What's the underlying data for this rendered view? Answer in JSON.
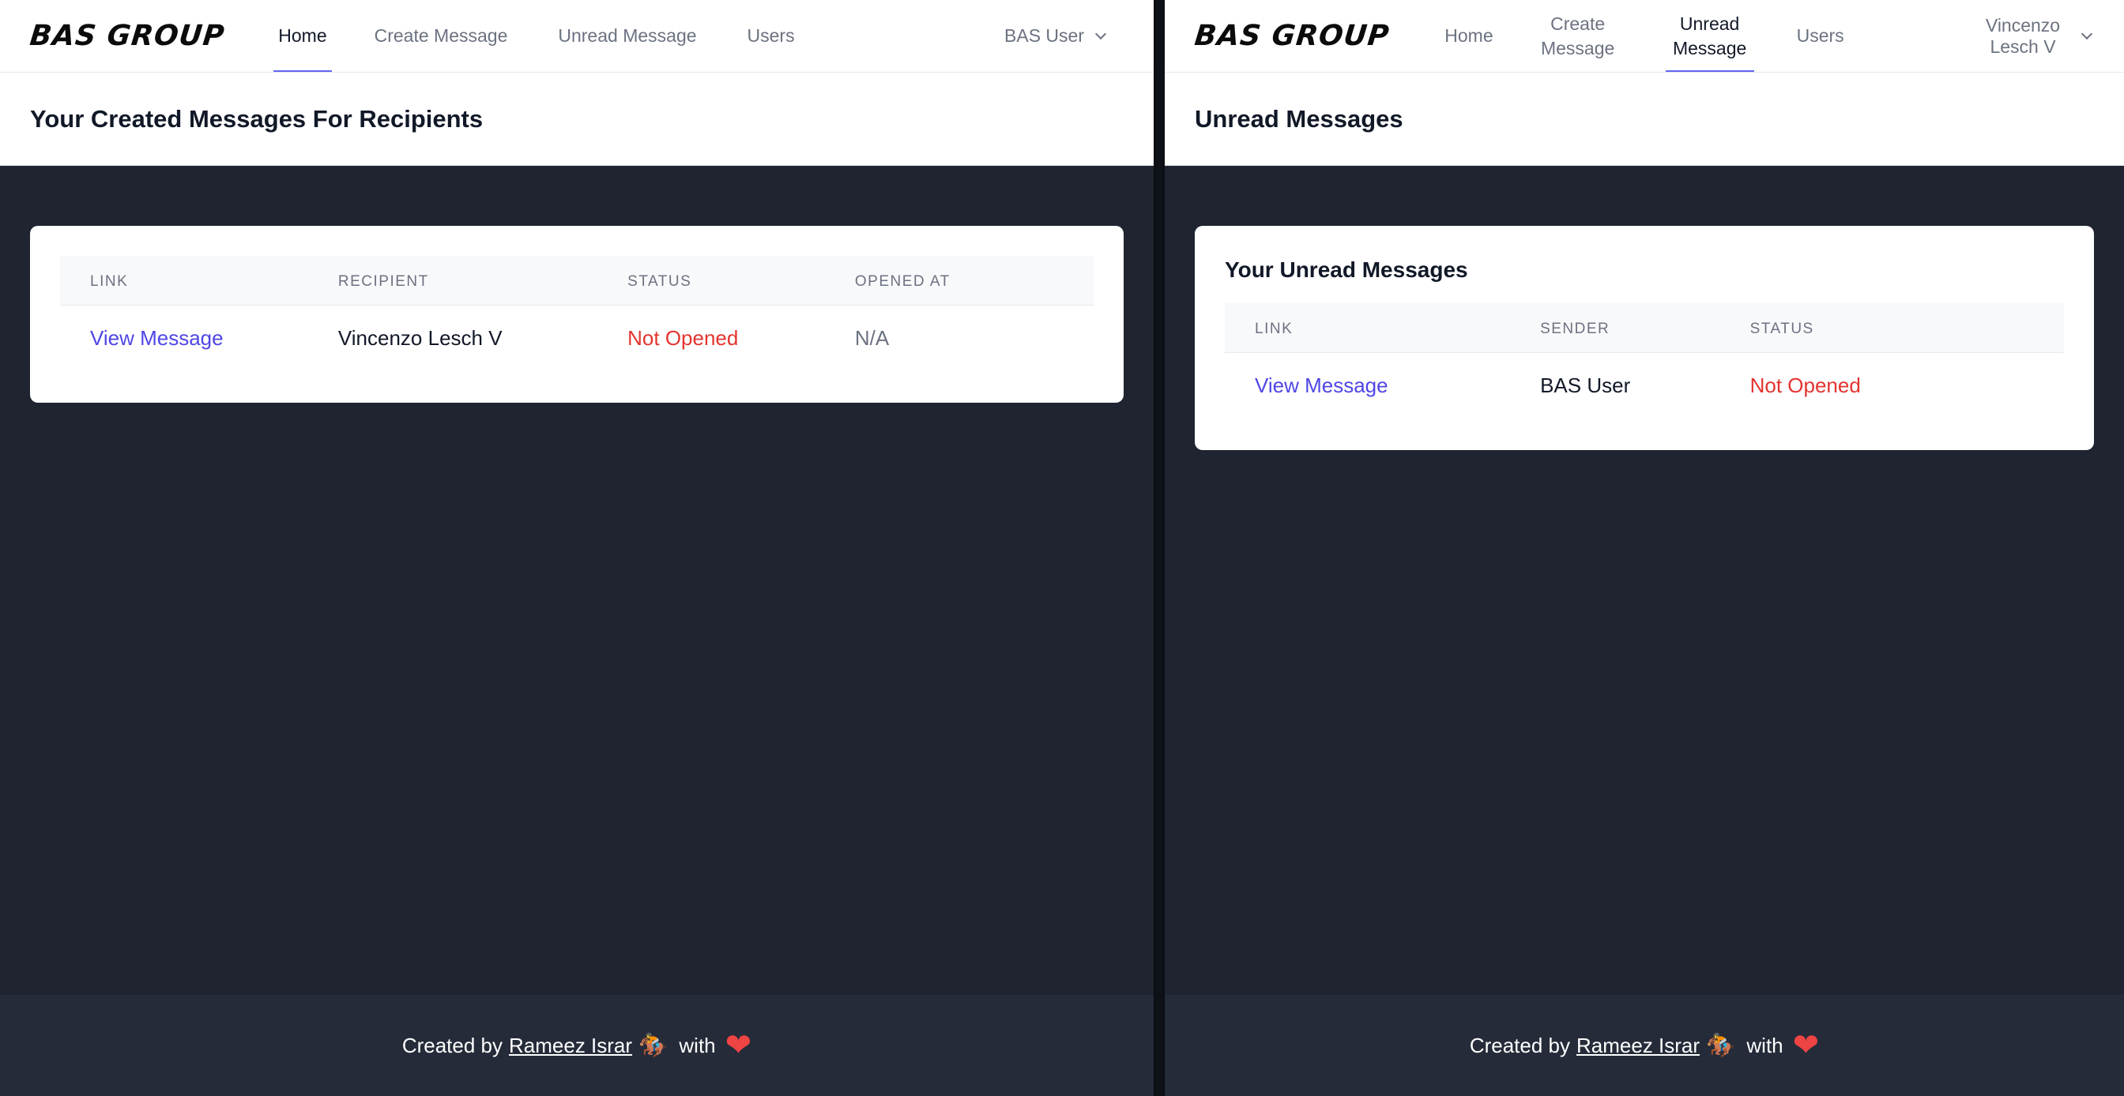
{
  "left": {
    "logo": "BAS GROUP",
    "nav": [
      "Home",
      "Create Message",
      "Unread Message",
      "Users"
    ],
    "user": "BAS User",
    "page_title": "Your Created Messages For Recipients",
    "table": {
      "headers": [
        "LINK",
        "RECIPIENT",
        "STATUS",
        "OPENED AT"
      ],
      "rows": [
        [
          "View Message",
          "Vincenzo Lesch V",
          "Not Opened",
          "N/A"
        ]
      ]
    }
  },
  "right": {
    "logo": "BAS GROUP",
    "nav": [
      "Home",
      "Create Message",
      "Unread Message",
      "Users"
    ],
    "user": "Vincenzo Lesch V",
    "page_title": "Unread Messages",
    "card_title": "Your Unread Messages",
    "table": {
      "headers": [
        "LINK",
        "SENDER",
        "STATUS"
      ],
      "rows": [
        [
          "View Message",
          "BAS User",
          "Not Opened"
        ]
      ]
    }
  },
  "footer": {
    "prefix": "Created by",
    "author": "Rameez Israr",
    "rider": "🏇",
    "with": "with",
    "heart": "❤"
  },
  "colors": {
    "accent": "#6366f1",
    "link": "#4f46e5",
    "status_not_opened": "#e3342f",
    "background": "#1f2430"
  }
}
